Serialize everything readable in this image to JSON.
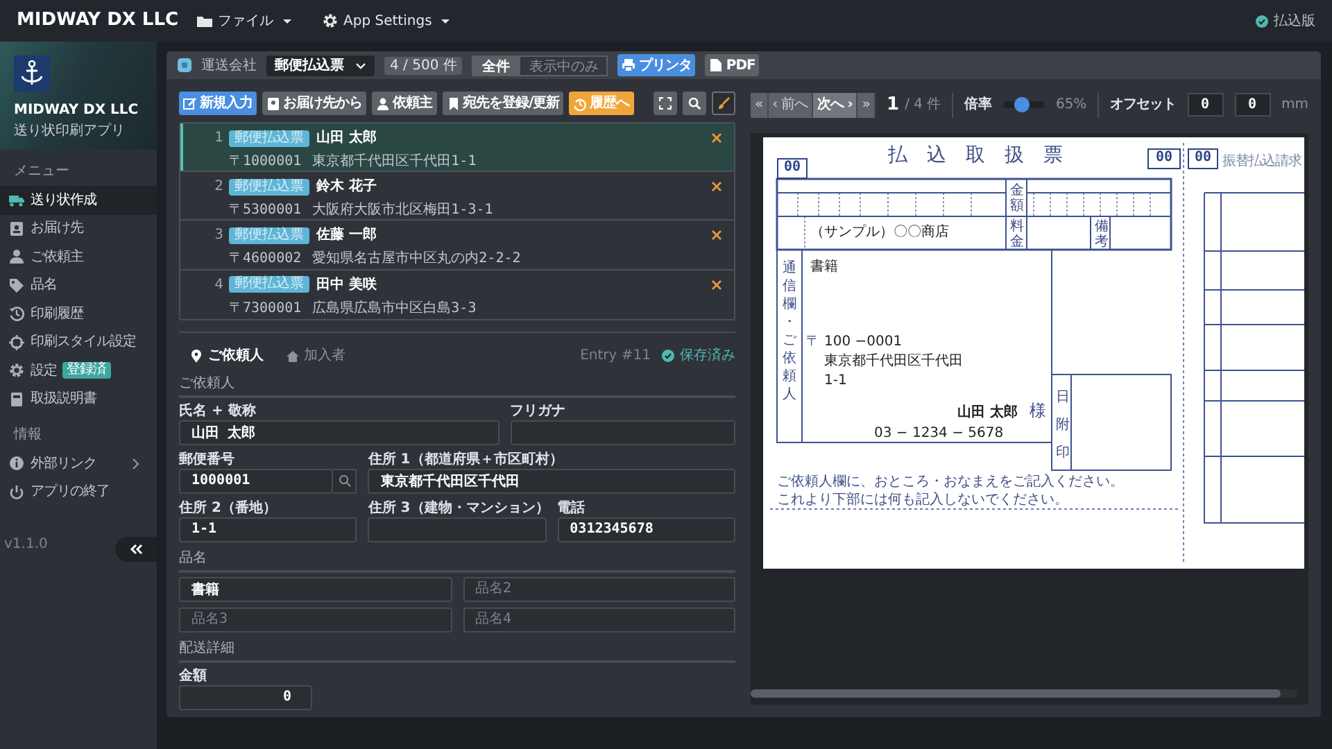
{
  "navbar": {
    "brand": "MIDWAY DX LLC",
    "menus": [
      "ファイル",
      "App Settings"
    ],
    "status": "払込版"
  },
  "sidebar": {
    "app_name": "MIDWAY DX LLC",
    "app_subtitle": "送り状印刷アプリ",
    "sections": [
      {
        "heading": "メニュー",
        "items": [
          {
            "label": "送り状作成",
            "selected": true
          },
          {
            "label": "お届け先",
            "selected": false
          },
          {
            "label": "ご依頼主",
            "selected": false
          },
          {
            "label": "品名",
            "selected": false
          },
          {
            "label": "印刷履歴",
            "selected": false
          },
          {
            "label": "印刷スタイル設定",
            "selected": false
          },
          {
            "label": "設定",
            "selected": false,
            "badge": "登録済"
          },
          {
            "label": "取扱説明書",
            "selected": false
          }
        ]
      },
      {
        "heading": "情報",
        "items": [
          {
            "label": "外部リンク",
            "selected": false,
            "submenu": true
          },
          {
            "label": "アプリの終了",
            "selected": false
          }
        ]
      }
    ],
    "version": "v1.1.0"
  },
  "toolbar": {
    "carrier_label": "運送会社",
    "carrier": "郵便払込票",
    "count": "4 / 500 件",
    "filter": [
      {
        "label": "全件",
        "selected": true
      },
      {
        "label": "表示中のみ",
        "selected": false
      }
    ],
    "buttons": [
      {
        "label": "プリンタ",
        "kind": "primary"
      },
      {
        "label": "PDF",
        "kind": "secondary"
      }
    ]
  },
  "actions": [
    {
      "label": "新規入力",
      "kind": "primary"
    },
    {
      "label": "お届け先から",
      "kind": "secondary"
    },
    {
      "label": "依頼主",
      "kind": "secondary"
    },
    {
      "label": "宛先を登録/更新",
      "kind": "secondary"
    },
    {
      "label": "履歴へ",
      "kind": "warning"
    }
  ],
  "entries": [
    {
      "number": "1",
      "tag": "郵便払込票",
      "name": "山田 太郎",
      "postal": "〒1000001",
      "address": "東京都千代田区千代田1-1",
      "selected": true
    },
    {
      "number": "2",
      "tag": "郵便払込票",
      "name": "鈴木 花子",
      "postal": "〒5300001",
      "address": "大阪府大阪市北区梅田1-3-1",
      "selected": false
    },
    {
      "number": "3",
      "tag": "郵便払込票",
      "name": "佐藤 一郎",
      "postal": "〒4600002",
      "address": "愛知県名古屋市中区丸の内2-2-2",
      "selected": false
    },
    {
      "number": "4",
      "tag": "郵便払込票",
      "name": "田中 美咲",
      "postal": "〒7300001",
      "address": "広島県広島市中区白島3-3",
      "selected": false
    }
  ],
  "form": {
    "tabs": [
      {
        "label": "ご依頼人",
        "selected": true
      },
      {
        "label": "加入者",
        "selected": false
      }
    ],
    "entry": "Entry #11",
    "save_status": "保存済み",
    "sections": [
      {
        "title": "ご依頼人",
        "rows": [
          [
            {
              "label": "氏名 + 敬称",
              "value": "山田 太郎"
            },
            {
              "label": "フリガナ"
            }
          ],
          [
            {
              "label": "郵便番号",
              "value": "1000001",
              "kind": "lookup"
            },
            {
              "label": "住所 1（都道府県＋市区町村）",
              "value": "東京都千代田区千代田"
            }
          ],
          [
            {
              "label": "住所 2（番地）",
              "value": "1-1"
            },
            {
              "label": "住所 3（建物・マンション）"
            },
            {
              "label": "電話",
              "value": "0312345678"
            }
          ]
        ]
      },
      {
        "title": "品名",
        "rows": [
          [
            {
              "value": "書籍"
            },
            {
              "placeholder": "品名2"
            }
          ],
          [
            {
              "placeholder": "品名3"
            },
            {
              "placeholder": "品名4"
            }
          ]
        ]
      },
      {
        "title": "配送詳細",
        "rows": [
          [
            {
              "label": "金額",
              "value": "0",
              "kind": "amount"
            }
          ]
        ]
      }
    ]
  },
  "preview": {
    "pager": [
      "«",
      "‹ 前へ",
      "次へ ›",
      "»"
    ],
    "page": "1",
    "page_total": "/ 4 件",
    "zoom_label": "倍率",
    "zoom": {
      "level": 0.45,
      "reading": "65%"
    },
    "offset_label": "オフセット",
    "offsets": [
      "0",
      "0"
    ],
    "unit": "mm",
    "document": {
      "codes": [
        "00",
        "00",
        "00"
      ],
      "title": "払込取扱票",
      "stub_title": "振替払込請求",
      "labels": [
        "金額",
        "料金",
        "備考"
      ],
      "subscriber": "（サンプル）〇〇商店",
      "message_label": "通信欄・ご依頼人",
      "item": "書籍",
      "postal_mark": "〒",
      "postal": "100 −0001",
      "address": [
        "東京都千代田区千代田",
        "1-1"
      ],
      "name": "山田 太郎",
      "honorific": "様",
      "phone": "03 − 1234 − 5678",
      "stamp_label": "日附印",
      "notes": [
        "ご依頼人欄に、おところ・おなまえをご記入ください。",
        "これより下部には何も記入しないでください。"
      ]
    }
  }
}
